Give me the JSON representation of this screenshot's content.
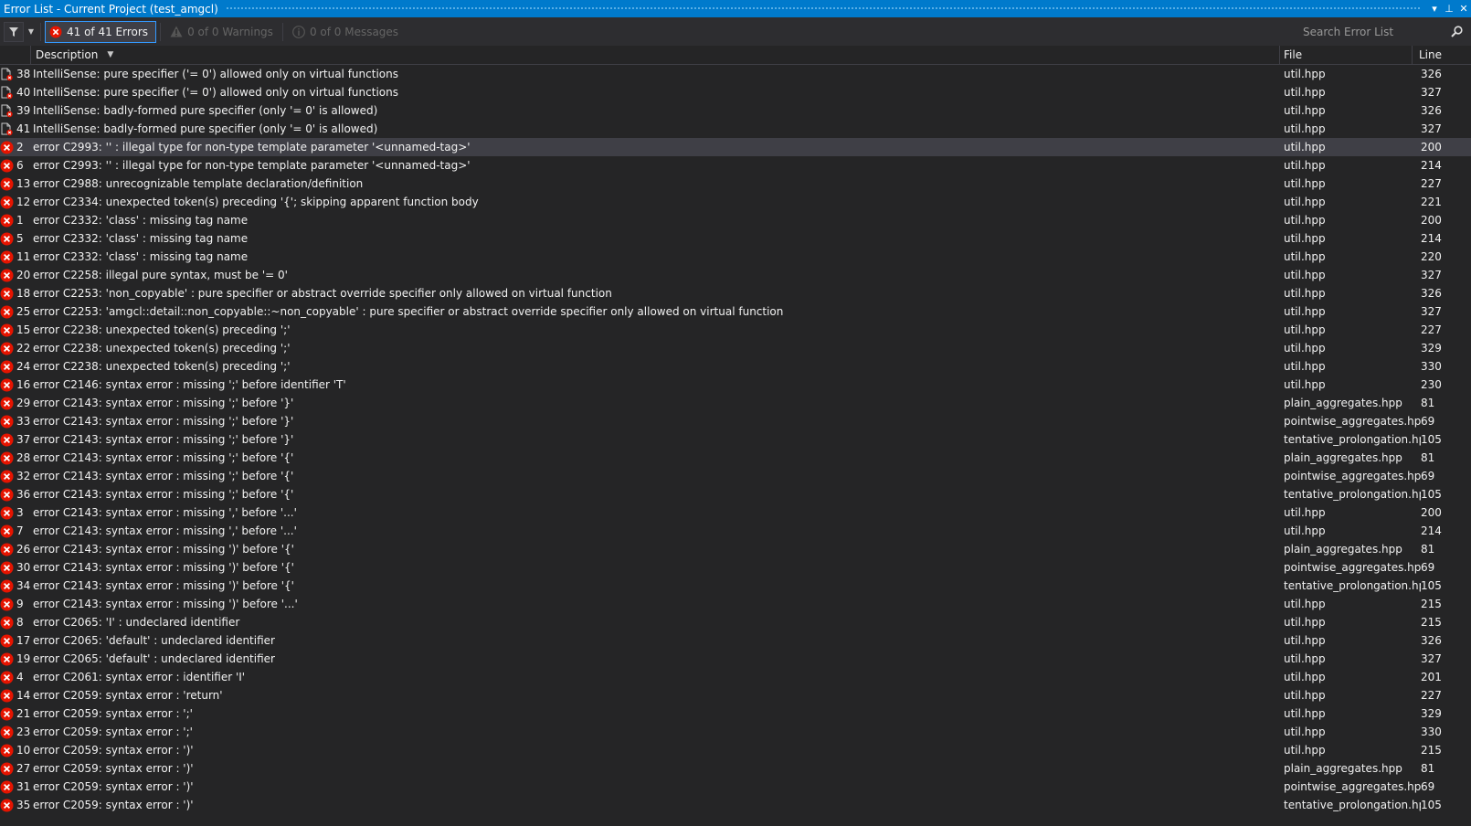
{
  "title": "Error List - Current Project (test_amgcl)",
  "title_buttons": [
    "▾",
    "⊥",
    "✕"
  ],
  "toolbar": {
    "errors_label": "41 of 41 Errors",
    "warnings_label": "0 of 0 Warnings",
    "messages_label": "0 of 0 Messages",
    "search_placeholder": "Search Error List"
  },
  "columns": {
    "description": "Description",
    "file": "File",
    "line": "Line"
  },
  "colors": {
    "accent": "#007acc",
    "error": "#e51400",
    "selected_row": "#3f3f46"
  },
  "rows": [
    {
      "icon": "intellisense-error-icon",
      "num": "38",
      "desc": "IntelliSense: pure specifier ('= 0') allowed only on virtual functions",
      "file": "util.hpp",
      "line": "326"
    },
    {
      "icon": "intellisense-error-icon",
      "num": "40",
      "desc": "IntelliSense: pure specifier ('= 0') allowed only on virtual functions",
      "file": "util.hpp",
      "line": "327"
    },
    {
      "icon": "intellisense-error-icon",
      "num": "39",
      "desc": "IntelliSense: badly-formed pure specifier (only '= 0' is allowed)",
      "file": "util.hpp",
      "line": "326"
    },
    {
      "icon": "intellisense-error-icon",
      "num": "41",
      "desc": "IntelliSense: badly-formed pure specifier (only '= 0' is allowed)",
      "file": "util.hpp",
      "line": "327"
    },
    {
      "icon": "error-icon",
      "num": "2",
      "desc": "error C2993: '' : illegal type for non-type template parameter '<unnamed-tag>'",
      "file": "util.hpp",
      "line": "200",
      "selected": true
    },
    {
      "icon": "error-icon",
      "num": "6",
      "desc": "error C2993: '' : illegal type for non-type template parameter '<unnamed-tag>'",
      "file": "util.hpp",
      "line": "214"
    },
    {
      "icon": "error-icon",
      "num": "13",
      "desc": "error C2988: unrecognizable template declaration/definition",
      "file": "util.hpp",
      "line": "227"
    },
    {
      "icon": "error-icon",
      "num": "12",
      "desc": "error C2334: unexpected token(s) preceding '{'; skipping apparent function body",
      "file": "util.hpp",
      "line": "221"
    },
    {
      "icon": "error-icon",
      "num": "1",
      "desc": "error C2332: 'class' : missing tag name",
      "file": "util.hpp",
      "line": "200"
    },
    {
      "icon": "error-icon",
      "num": "5",
      "desc": "error C2332: 'class' : missing tag name",
      "file": "util.hpp",
      "line": "214"
    },
    {
      "icon": "error-icon",
      "num": "11",
      "desc": "error C2332: 'class' : missing tag name",
      "file": "util.hpp",
      "line": "220"
    },
    {
      "icon": "error-icon",
      "num": "20",
      "desc": "error C2258: illegal pure syntax, must be '= 0'",
      "file": "util.hpp",
      "line": "327"
    },
    {
      "icon": "error-icon",
      "num": "18",
      "desc": "error C2253: 'non_copyable' : pure specifier or abstract override specifier only allowed on virtual function",
      "file": "util.hpp",
      "line": "326"
    },
    {
      "icon": "error-icon",
      "num": "25",
      "desc": "error C2253: 'amgcl::detail::non_copyable::~non_copyable' : pure specifier or abstract override specifier only allowed on virtual function",
      "file": "util.hpp",
      "line": "327"
    },
    {
      "icon": "error-icon",
      "num": "15",
      "desc": "error C2238: unexpected token(s) preceding ';'",
      "file": "util.hpp",
      "line": "227"
    },
    {
      "icon": "error-icon",
      "num": "22",
      "desc": "error C2238: unexpected token(s) preceding ';'",
      "file": "util.hpp",
      "line": "329"
    },
    {
      "icon": "error-icon",
      "num": "24",
      "desc": "error C2238: unexpected token(s) preceding ';'",
      "file": "util.hpp",
      "line": "330"
    },
    {
      "icon": "error-icon",
      "num": "16",
      "desc": "error C2146: syntax error : missing ';' before identifier 'T'",
      "file": "util.hpp",
      "line": "230"
    },
    {
      "icon": "error-icon",
      "num": "29",
      "desc": "error C2143: syntax error : missing ';' before '}'",
      "file": "plain_aggregates.hpp",
      "line": "81"
    },
    {
      "icon": "error-icon",
      "num": "33",
      "desc": "error C2143: syntax error : missing ';' before '}'",
      "file": "pointwise_aggregates.hpp",
      "line": "69"
    },
    {
      "icon": "error-icon",
      "num": "37",
      "desc": "error C2143: syntax error : missing ';' before '}'",
      "file": "tentative_prolongation.hpp",
      "line": "105"
    },
    {
      "icon": "error-icon",
      "num": "28",
      "desc": "error C2143: syntax error : missing ';' before '{'",
      "file": "plain_aggregates.hpp",
      "line": "81"
    },
    {
      "icon": "error-icon",
      "num": "32",
      "desc": "error C2143: syntax error : missing ';' before '{'",
      "file": "pointwise_aggregates.hpp",
      "line": "69"
    },
    {
      "icon": "error-icon",
      "num": "36",
      "desc": "error C2143: syntax error : missing ';' before '{'",
      "file": "tentative_prolongation.hpp",
      "line": "105"
    },
    {
      "icon": "error-icon",
      "num": "3",
      "desc": "error C2143: syntax error : missing ',' before '...'",
      "file": "util.hpp",
      "line": "200"
    },
    {
      "icon": "error-icon",
      "num": "7",
      "desc": "error C2143: syntax error : missing ',' before '...'",
      "file": "util.hpp",
      "line": "214"
    },
    {
      "icon": "error-icon",
      "num": "26",
      "desc": "error C2143: syntax error : missing ')' before '{'",
      "file": "plain_aggregates.hpp",
      "line": "81"
    },
    {
      "icon": "error-icon",
      "num": "30",
      "desc": "error C2143: syntax error : missing ')' before '{'",
      "file": "pointwise_aggregates.hpp",
      "line": "69"
    },
    {
      "icon": "error-icon",
      "num": "34",
      "desc": "error C2143: syntax error : missing ')' before '{'",
      "file": "tentative_prolongation.hpp",
      "line": "105"
    },
    {
      "icon": "error-icon",
      "num": "9",
      "desc": "error C2143: syntax error : missing ')' before '...'",
      "file": "util.hpp",
      "line": "215"
    },
    {
      "icon": "error-icon",
      "num": "8",
      "desc": "error C2065: 'I' : undeclared identifier",
      "file": "util.hpp",
      "line": "215"
    },
    {
      "icon": "error-icon",
      "num": "17",
      "desc": "error C2065: 'default' : undeclared identifier",
      "file": "util.hpp",
      "line": "326"
    },
    {
      "icon": "error-icon",
      "num": "19",
      "desc": "error C2065: 'default' : undeclared identifier",
      "file": "util.hpp",
      "line": "327"
    },
    {
      "icon": "error-icon",
      "num": "4",
      "desc": "error C2061: syntax error : identifier 'I'",
      "file": "util.hpp",
      "line": "201"
    },
    {
      "icon": "error-icon",
      "num": "14",
      "desc": "error C2059: syntax error : 'return'",
      "file": "util.hpp",
      "line": "227"
    },
    {
      "icon": "error-icon",
      "num": "21",
      "desc": "error C2059: syntax error : ';'",
      "file": "util.hpp",
      "line": "329"
    },
    {
      "icon": "error-icon",
      "num": "23",
      "desc": "error C2059: syntax error : ';'",
      "file": "util.hpp",
      "line": "330"
    },
    {
      "icon": "error-icon",
      "num": "10",
      "desc": "error C2059: syntax error : ')'",
      "file": "util.hpp",
      "line": "215"
    },
    {
      "icon": "error-icon",
      "num": "27",
      "desc": "error C2059: syntax error : ')'",
      "file": "plain_aggregates.hpp",
      "line": "81"
    },
    {
      "icon": "error-icon",
      "num": "31",
      "desc": "error C2059: syntax error : ')'",
      "file": "pointwise_aggregates.hpp",
      "line": "69"
    },
    {
      "icon": "error-icon",
      "num": "35",
      "desc": "error C2059: syntax error : ')'",
      "file": "tentative_prolongation.hpp",
      "line": "105"
    }
  ]
}
